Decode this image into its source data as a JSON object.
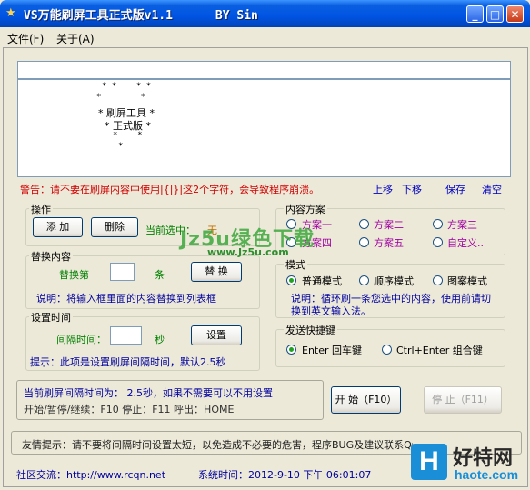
{
  "window": {
    "title": "VS万能刷屏工具正式版v1.1      BY Sin"
  },
  "menu": {
    "file": "文件(F)",
    "about": "关于(A)"
  },
  "preview": {
    "art_rows": [
      "* *    * *",
      "*        *",
      "*  刷屏工具  *",
      "*  正式版  *",
      "*    *",
      "*"
    ]
  },
  "warning": "警告：请不要在刷屏内容中使用|{|}|这2个字符，会导致程序崩溃。",
  "actions": {
    "up": "上移",
    "down": "下移",
    "save": "保存",
    "clear": "清空"
  },
  "operate": {
    "label": "操作",
    "add": "添 加",
    "delete": "删除",
    "selected_label": "当前选中：",
    "selected_value": "无"
  },
  "replace": {
    "label": "替换内容",
    "prefix": "替换第",
    "suffix": "条",
    "button": "替 换",
    "note": "说明：将输入框里面的内容替换到列表框"
  },
  "interval": {
    "label": "设置时间",
    "field_label": "间隔时间：",
    "unit": "秒",
    "button": "设置",
    "note": "提示：此项是设置刷屏间隔时间，默认2.5秒"
  },
  "scheme": {
    "label": "内容方案",
    "options": [
      "方案一",
      "方案二",
      "方案三",
      "方案四",
      "方案五",
      "自定义.."
    ]
  },
  "mode": {
    "label": "模式",
    "options": [
      "普通模式",
      "顺序模式",
      "图案模式"
    ],
    "selected": "普通模式",
    "note": "说明：循环刷一条您选中的内容，使用前请切换到英文输入法。"
  },
  "hotkey": {
    "label": "发送快捷键",
    "options": [
      "Enter 回车键",
      "Ctrl+Enter 组合键"
    ],
    "selected": "Enter 回车键"
  },
  "status_info": {
    "line1": "当前刷屏间隔时间为： 2.5秒，如果不需要可以不用设置",
    "line2": "开始/暂停/继续：F10    停止：F11    呼出：HOME"
  },
  "controls": {
    "start": "开 始（F10）",
    "stop": "停 止（F11）"
  },
  "tip": "友情提示：请不要将间隔时间设置太短，以免造成不必要的危害，程序BUG及建议联系QQ：203297",
  "footer": {
    "community": "社区交流：http://www.rcqn.net",
    "system_time": "系统时间：2012-9-10 下午 06:01:07"
  },
  "watermark": {
    "text": "Jz5u绿色下载",
    "url": "www.Jz5u.com"
  },
  "logo": {
    "mark": "H",
    "name": "好特网",
    "url": "haote.com"
  },
  "colors": {
    "title_bar": "#0054e3",
    "warning": "#d00000",
    "link": "#0000c0",
    "green": "#008000",
    "purple": "#a000a0"
  }
}
